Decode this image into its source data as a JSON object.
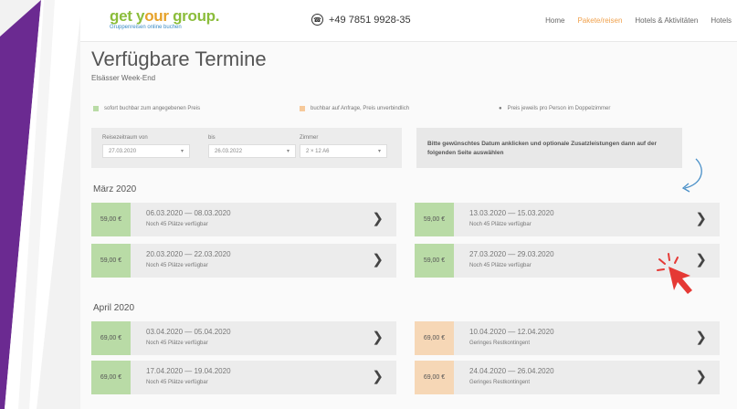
{
  "colors": {
    "purple": "#6b2a91",
    "green": "#b9dba6",
    "orange": "#f6d7b6",
    "nav_active": "#f0a04b",
    "cursor_red": "#e53935",
    "arrow_blue": "#4a90c8"
  },
  "header": {
    "logo_part1": "get y",
    "logo_part2": "our",
    "logo_part3": " group.",
    "logo_tagline": "Gruppenreisen online buchen",
    "phone_icon": "phone-icon",
    "phone": "+49 7851 9928-35",
    "nav": [
      "Home",
      "Pakete/reisen",
      "Hotels & Aktivitäten",
      "Hotels"
    ]
  },
  "page": {
    "title": "Verfügbare Termine",
    "subtitle": "Elsässer Week-End"
  },
  "legend": {
    "instant": "sofort buchbar zum angegebenen Preis",
    "on_request": "buchbar auf Anfrage, Preis unverbindlich",
    "per_person": "Preis jeweils pro Person im Doppelzimmer"
  },
  "filters": {
    "from_label": "Reisezeitraum von",
    "from_value": "27.03.2020",
    "to_label": "bis",
    "to_value": "26.03.2022",
    "rooms_label": "Zimmer",
    "rooms_value": "2 ×   12 A6"
  },
  "info": "Bitte gewünschtes Datum anklicken und optionale Zusatzleistungen dann auf der folgenden Seite auswählen",
  "months": [
    "März 2020",
    "April 2020"
  ],
  "rows": [
    {
      "price": "59,00 €",
      "dates": "06.03.2020 — 08.03.2020",
      "avail": "Noch 45 Plätze verfügbar",
      "status": "green"
    },
    {
      "price": "59,00 €",
      "dates": "13.03.2020 — 15.03.2020",
      "avail": "Noch 45 Plätze verfügbar",
      "status": "green"
    },
    {
      "price": "59,00 €",
      "dates": "20.03.2020 — 22.03.2020",
      "avail": "Noch 45 Plätze verfügbar",
      "status": "green"
    },
    {
      "price": "59,00 €",
      "dates": "27.03.2020 — 29.03.2020",
      "avail": "Noch 45 Plätze verfügbar",
      "status": "green"
    },
    {
      "price": "69,00 €",
      "dates": "03.04.2020 — 05.04.2020",
      "avail": "Noch 45 Plätze verfügbar",
      "status": "green"
    },
    {
      "price": "69,00 €",
      "dates": "10.04.2020 — 12.04.2020",
      "avail": "Geringes Restkontingent",
      "status": "orange"
    },
    {
      "price": "69,00 €",
      "dates": "17.04.2020 — 19.04.2020",
      "avail": "Noch 45 Plätze verfügbar",
      "status": "green"
    },
    {
      "price": "69,00 €",
      "dates": "24.04.2020 — 26.04.2020",
      "avail": "Geringes Restkontingent",
      "status": "orange"
    }
  ]
}
